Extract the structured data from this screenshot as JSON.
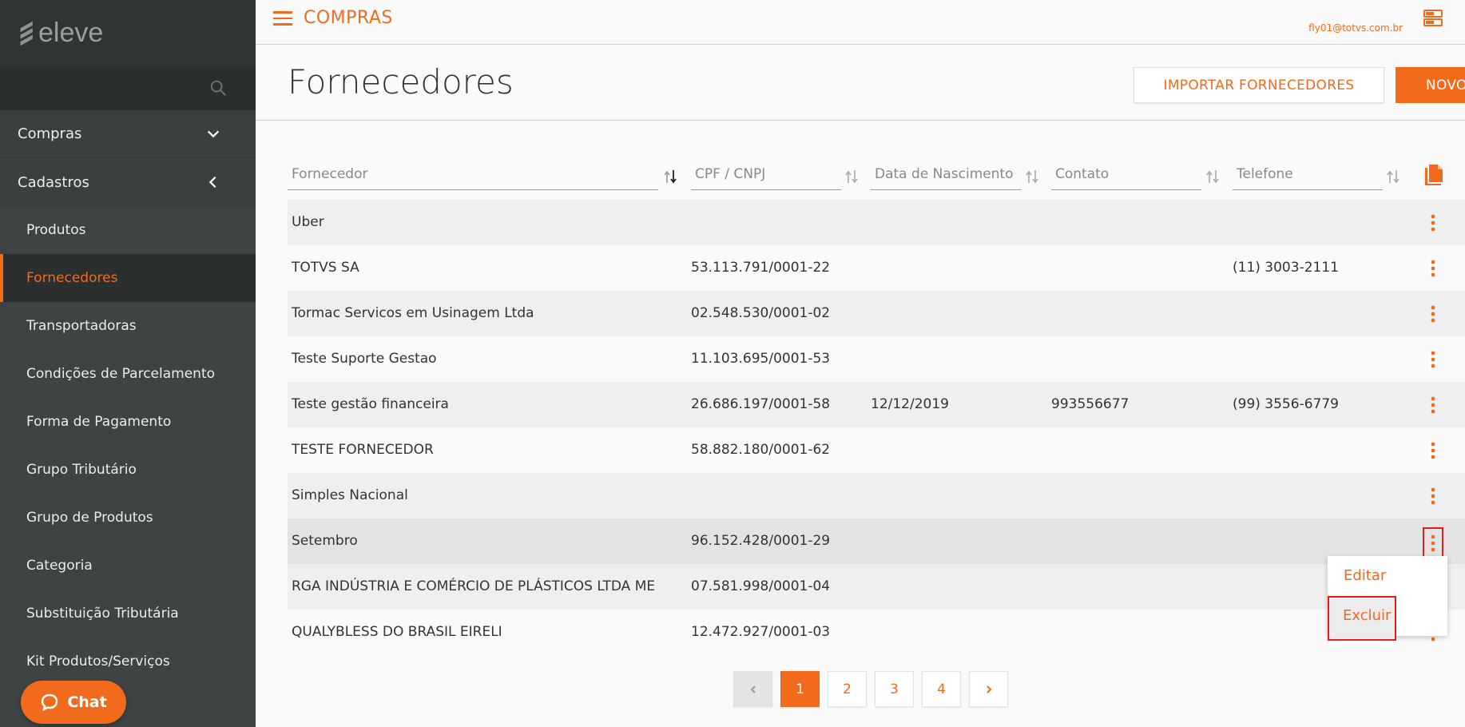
{
  "brand": {
    "logo_text": "eleve"
  },
  "sidebar": {
    "groups": [
      {
        "label": "Compras",
        "state": "expanded"
      },
      {
        "label": "Cadastros",
        "state": "collapsed"
      }
    ],
    "items": [
      {
        "label": "Produtos"
      },
      {
        "label": "Fornecedores",
        "active": true
      },
      {
        "label": "Transportadoras"
      },
      {
        "label": "Condições de Parcelamento"
      },
      {
        "label": "Forma de Pagamento"
      },
      {
        "label": "Grupo Tributário"
      },
      {
        "label": "Grupo de Produtos"
      },
      {
        "label": "Categoria"
      },
      {
        "label": "Substituição Tributária"
      },
      {
        "label": "Kit Produtos/Serviços"
      }
    ]
  },
  "chat": {
    "label": "Chat"
  },
  "topbar": {
    "module": "COMPRAS",
    "user_email": "fly01@totvs.com.br"
  },
  "header": {
    "title": "Fornecedores",
    "import_label": "IMPORTAR FORNECEDORES",
    "new_label": "NOVO"
  },
  "table": {
    "columns": [
      "Fornecedor",
      "CPF / CNPJ",
      "Data de Nascimento",
      "Contato",
      "Telefone"
    ],
    "rows": [
      {
        "fornecedor": "Uber",
        "cnpj": "",
        "nascimento": "",
        "contato": "",
        "telefone": ""
      },
      {
        "fornecedor": "TOTVS SA",
        "cnpj": "53.113.791/0001-22",
        "nascimento": "",
        "contato": "",
        "telefone": "(11) 3003-2111"
      },
      {
        "fornecedor": "Tormac Servicos em Usinagem Ltda",
        "cnpj": "02.548.530/0001-02",
        "nascimento": "",
        "contato": "",
        "telefone": ""
      },
      {
        "fornecedor": "Teste Suporte Gestao",
        "cnpj": "11.103.695/0001-53",
        "nascimento": "",
        "contato": "",
        "telefone": ""
      },
      {
        "fornecedor": "Teste gestão financeira",
        "cnpj": "26.686.197/0001-58",
        "nascimento": "12/12/2019",
        "contato": "993556677",
        "telefone": "(99) 3556-6779"
      },
      {
        "fornecedor": "TESTE FORNECEDOR",
        "cnpj": "58.882.180/0001-62",
        "nascimento": "",
        "contato": "",
        "telefone": ""
      },
      {
        "fornecedor": "Simples Nacional",
        "cnpj": "",
        "nascimento": "",
        "contato": "",
        "telefone": ""
      },
      {
        "fornecedor": "Setembro",
        "cnpj": "96.152.428/0001-29",
        "nascimento": "",
        "contato": "",
        "telefone": ""
      },
      {
        "fornecedor": "RGA INDÚSTRIA E COMÉRCIO DE PLÁSTICOS LTDA ME",
        "cnpj": "07.581.998/0001-04",
        "nascimento": "",
        "contato": "",
        "telefone": ""
      },
      {
        "fornecedor": "QUALYBLESS DO BRASIL EIRELI",
        "cnpj": "12.472.927/0001-03",
        "nascimento": "",
        "contato": "",
        "telefone": ""
      }
    ]
  },
  "row_menu": {
    "edit_label": "Editar",
    "delete_label": "Excluir"
  },
  "pagination": {
    "pages": [
      "1",
      "2",
      "3",
      "4"
    ],
    "current": "1"
  },
  "colors": {
    "accent": "#f26a1b",
    "sidebar_bg": "#3a3f40",
    "highlight_border": "#e21b1b"
  }
}
